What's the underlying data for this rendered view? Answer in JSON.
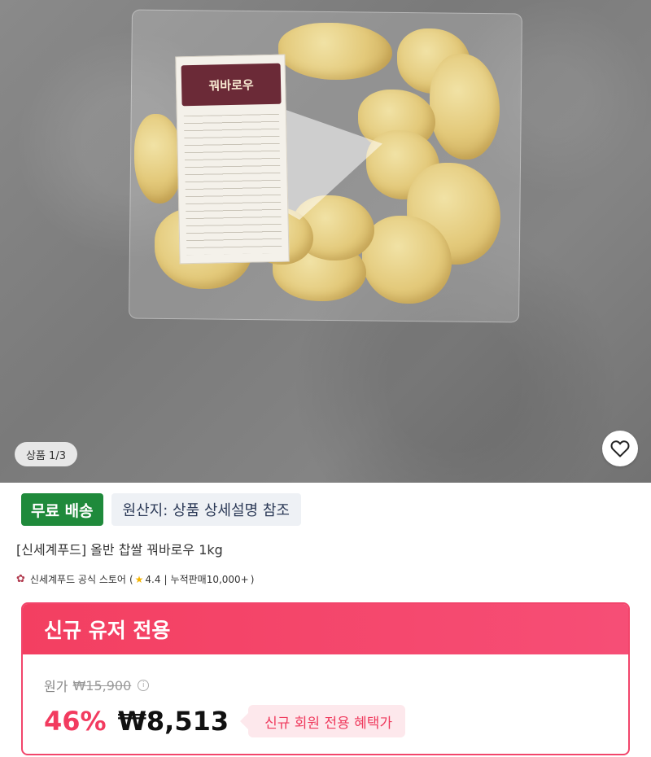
{
  "image": {
    "label_text": "꿔바로우",
    "page_indicator": "상품 1/3"
  },
  "tags": {
    "free_shipping": "무료 배송",
    "origin": "원산지: 상품 상세설명 참조"
  },
  "product": {
    "name": "[신세계푸드] 올반 찹쌀 꿔바로우 1kg"
  },
  "store": {
    "name": "신세계푸드 공식 스토어",
    "open_paren": "(",
    "rating": "4.4",
    "separator": "|",
    "sales": "누적판매10,000+",
    "close_paren": ")"
  },
  "promo": {
    "header": "신규 유저 전용",
    "original_label": "원가",
    "original_price": "₩15,900",
    "discount": "46%",
    "price": "₩8,513",
    "benefit": "신규 회원 전용 혜택가"
  },
  "colors": {
    "accent": "#f23b5f",
    "free_shipping_bg": "#1f8a3b"
  },
  "icons": {
    "heart": "heart-icon",
    "store": "flower-icon",
    "star": "star-icon",
    "info": "info-icon"
  }
}
